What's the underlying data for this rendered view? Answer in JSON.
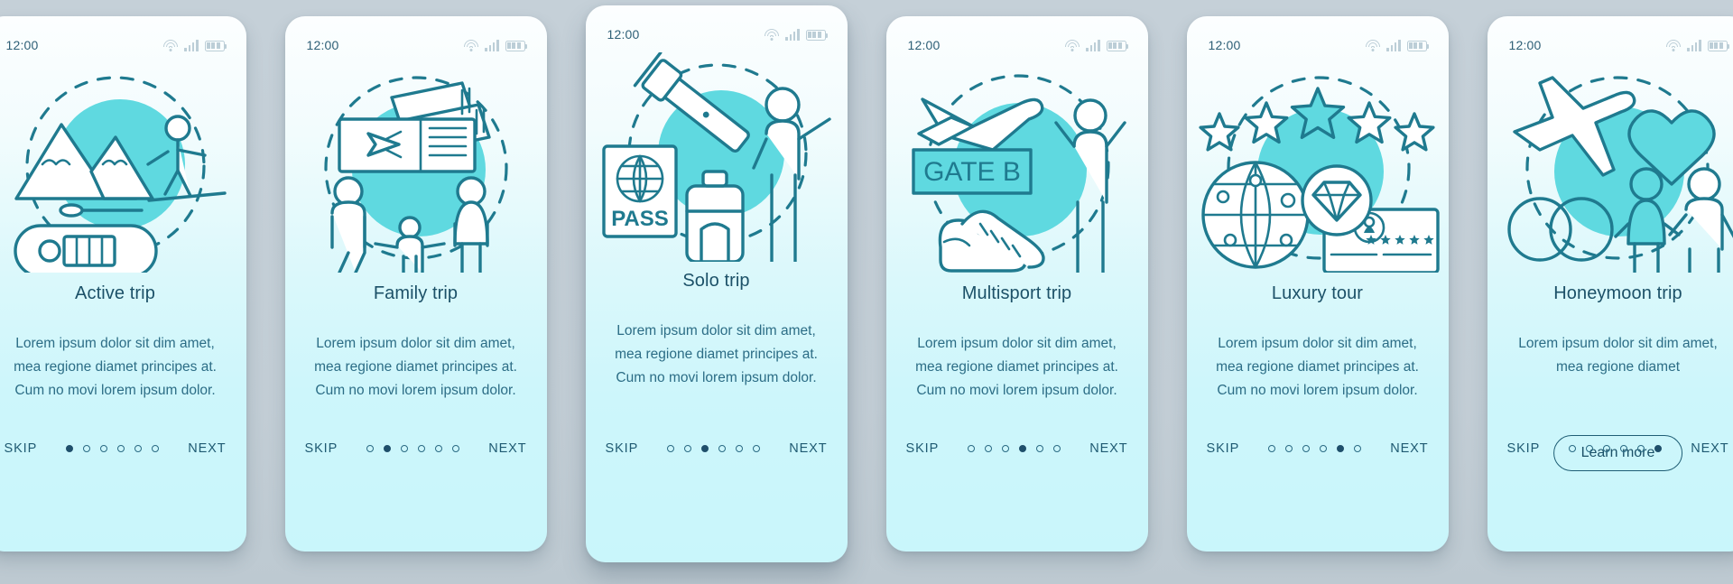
{
  "background_color": "#c3ced6",
  "theme": {
    "accent": "#5fd9e0",
    "line": "#1f7a8f",
    "title_color": "#1c5168",
    "body_color": "#2c6d86",
    "card_gradient_top": "#fcfeff",
    "card_gradient_bottom": "#c9f6fb"
  },
  "status_bar": {
    "time": "12:00",
    "icons": [
      "wifi-icon",
      "signal-icon",
      "battery-icon"
    ]
  },
  "nav": {
    "skip_label": "SKIP",
    "next_label": "NEXT",
    "total_dots": 6
  },
  "screens": [
    {
      "id": "active-trip",
      "title": "Active trip",
      "description": "Lorem ipsum dolor sit dim amet, mea regione diamet principes at. Cum no movi lorem ipsum dolor.",
      "illustration": "mountains-skier-raft",
      "illustration_elements": [
        "mountains-icon",
        "skier-icon",
        "raft-icon",
        "dashed-circle"
      ],
      "active_dot": 1,
      "elevated": false,
      "cta": null
    },
    {
      "id": "family-trip",
      "title": "Family trip",
      "description": "Lorem ipsum dolor sit dim amet, mea regione diamet principes at. Cum no movi lorem ipsum dolor.",
      "illustration": "tickets-family",
      "illustration_elements": [
        "plane-ticket-icon",
        "family-figures-icon",
        "dashed-circle"
      ],
      "active_dot": 2,
      "elevated": false,
      "cta": null
    },
    {
      "id": "solo-trip",
      "title": "Solo trip",
      "description": "Lorem ipsum dolor sit dim amet, mea regione diamet principes at. Cum no movi lorem ipsum dolor.",
      "illustration": "passport-telescope-suitcase",
      "illustration_elements": [
        "telescope-icon",
        "passport-icon",
        "suitcase-icon",
        "person-icon",
        "dashed-circle"
      ],
      "passport_label": "PASS",
      "active_dot": 3,
      "elevated": true,
      "cta": null
    },
    {
      "id": "multisport-trip",
      "title": "Multisport trip",
      "description": "Lorem ipsum dolor sit dim amet, mea regione diamet principes at. Cum no movi lorem ipsum dolor.",
      "illustration": "plane-gate-sneakers",
      "illustration_elements": [
        "airplane-icon",
        "gate-sign",
        "sneakers-icon",
        "person-cheering-icon",
        "dashed-circle"
      ],
      "gate_label": "GATE B",
      "active_dot": 4,
      "elevated": false,
      "cta": null
    },
    {
      "id": "luxury-tour",
      "title": "Luxury tour",
      "description": "Lorem ipsum dolor sit dim amet, mea regione diamet principes at. Cum no movi lorem ipsum dolor.",
      "illustration": "stars-globe-diamond-card",
      "illustration_elements": [
        "star-icon",
        "globe-icon",
        "diamond-badge-icon",
        "id-card-icon",
        "dashed-circle"
      ],
      "star_count": 5,
      "card_star_count": 5,
      "active_dot": 5,
      "elevated": false,
      "cta": null
    },
    {
      "id": "honeymoon-trip",
      "title": "Honeymoon trip",
      "description": "Lorem ipsum dolor sit dim amet, mea regione diamet",
      "illustration": "plane-heart-rings-couple",
      "illustration_elements": [
        "airplane-icon",
        "heart-icon",
        "wedding-rings-icon",
        "couple-icon",
        "dashed-circle"
      ],
      "active_dot": 6,
      "elevated": false,
      "cta": "Learn more"
    }
  ]
}
